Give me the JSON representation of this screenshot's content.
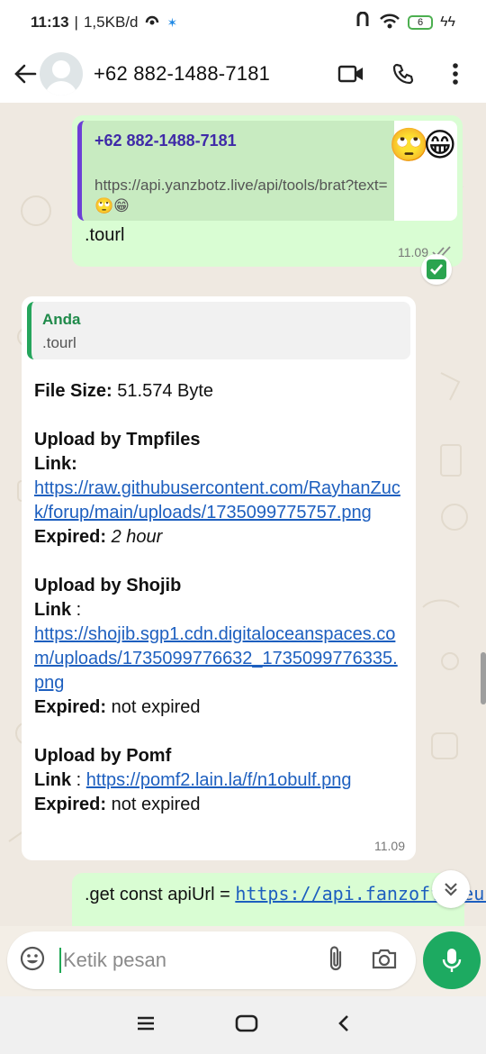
{
  "status_bar": {
    "time": "11:13",
    "net_speed": "1,5KB/d",
    "battery": "6"
  },
  "header": {
    "contact": "+62 882-1488-7181"
  },
  "messages": {
    "outgoing1": {
      "quote_name": "+62 882-1488-7181",
      "quote_text": "https://api.yanzbotz.live/api/tools/brat?text=🙄😁",
      "text": ".tourl",
      "time": "11.09"
    },
    "incoming1": {
      "quote_name": "Anda",
      "quote_text": ".tourl",
      "file_size_label": "File Size:",
      "file_size_value": "51.574 Byte",
      "tmp_title": "Upload by Tmpfiles",
      "tmp_link_label": "Link:",
      "tmp_link": "https://raw.githubusercontent.com/RayhanZuck/forup/main/uploads/1735099775757.png",
      "tmp_expired_label": "Expired:",
      "tmp_expired_value": "2 hour",
      "shojib_title": "Upload by Shojib",
      "shojib_link_label": "Link",
      "shojib_link_sep": " :",
      "shojib_link": "https://shojib.sgp1.cdn.digitaloceanspaces.com/uploads/1735099776632_1735099776335.png",
      "shojib_expired_label": "Expired:",
      "shojib_expired_value": "not expired",
      "pomf_title": "Upload by Pomf",
      "pomf_link_label": "Link",
      "pomf_link_sep": " : ",
      "pomf_link": "https://pomf2.lain.la/f/n1obulf.png",
      "pomf_expired_label": "Expired:",
      "pomf_expired_value": "not expired",
      "time": "11.09"
    },
    "outgoing2": {
      "prefix": ".get const apiUrl = ",
      "url": "https://api.fanzoffc.eu.org/api"
    }
  },
  "composer": {
    "placeholder": "Ketik pesan"
  }
}
